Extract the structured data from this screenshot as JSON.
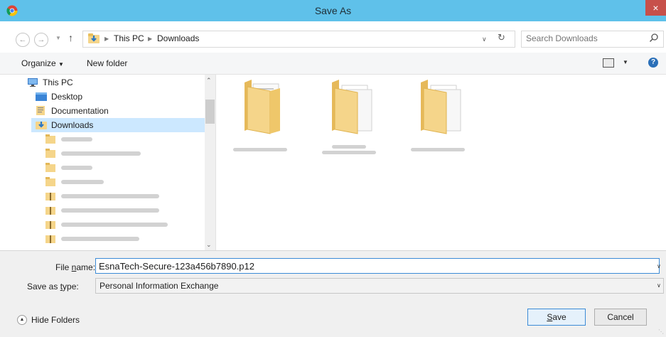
{
  "window": {
    "title": "Save As",
    "close_glyph": "×"
  },
  "address": {
    "breadcrumb": [
      "This PC",
      "Downloads"
    ],
    "search_placeholder": "Search Downloads"
  },
  "toolbar": {
    "organize_label": "Organize",
    "new_folder_label": "New folder"
  },
  "nav_tree": {
    "this_pc": "This PC",
    "items": [
      "Desktop",
      "Documentation",
      "Downloads"
    ]
  },
  "file_name": {
    "label_prefix": "File ",
    "label_underlined": "n",
    "label_suffix": "ame:",
    "value": "EsnaTech-Secure-123a456b7890.p12"
  },
  "save_as_type": {
    "label_prefix": "Save as ",
    "label_underlined": "t",
    "label_suffix": "ype:",
    "value": "Personal Information Exchange"
  },
  "footer": {
    "hide_folders": "Hide Folders",
    "save_underlined": "S",
    "save_rest": "ave",
    "cancel": "Cancel"
  },
  "colors": {
    "titlebar": "#5fc1ea",
    "close": "#c7504a",
    "selection": "#cce8ff",
    "folder": "#f5d58a"
  },
  "icons": [
    "chrome-icon",
    "back-arrow-icon",
    "forward-arrow-icon",
    "up-arrow-icon",
    "downloads-folder-icon",
    "refresh-icon",
    "search-icon",
    "view-icon",
    "help-icon",
    "pc-icon",
    "desktop-icon",
    "documents-icon",
    "folder-icon",
    "zip-folder-icon"
  ]
}
